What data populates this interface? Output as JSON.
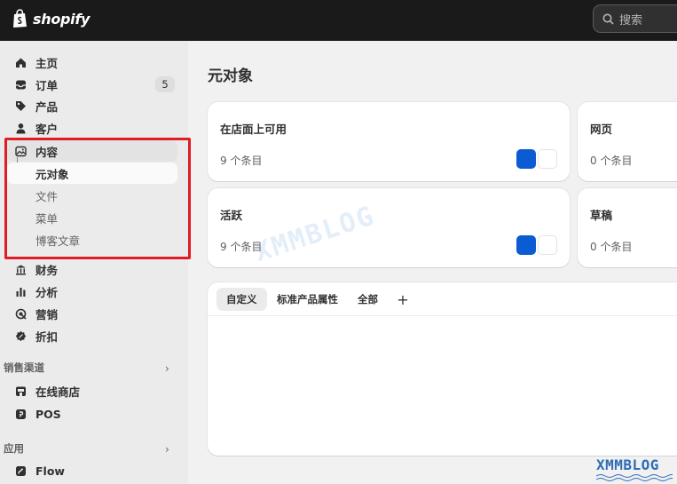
{
  "topbar": {
    "brand": "shopify",
    "search_placeholder": "搜索"
  },
  "sidebar": {
    "items": [
      {
        "label": "主页",
        "icon": "home-icon"
      },
      {
        "label": "订单",
        "icon": "inbox-icon",
        "badge": "5"
      },
      {
        "label": "产品",
        "icon": "tag-icon"
      },
      {
        "label": "客户",
        "icon": "person-icon"
      },
      {
        "label": "内容",
        "icon": "image-icon"
      },
      {
        "label": "财务",
        "icon": "bank-icon"
      },
      {
        "label": "分析",
        "icon": "bar-chart-icon"
      },
      {
        "label": "营销",
        "icon": "target-icon"
      },
      {
        "label": "折扣",
        "icon": "discount-icon"
      }
    ],
    "content_sub": [
      {
        "label": "元对象",
        "active": true
      },
      {
        "label": "文件"
      },
      {
        "label": "菜单"
      },
      {
        "label": "博客文章"
      }
    ],
    "sales_channels_label": "销售渠道",
    "channels": [
      {
        "label": "在线商店",
        "icon": "store-icon"
      },
      {
        "label": "POS",
        "icon": "pos-icon"
      }
    ],
    "apps_label": "应用",
    "apps": [
      {
        "label": "Flow",
        "icon": "flow-icon"
      }
    ]
  },
  "main": {
    "title": "元对象",
    "cards": [
      {
        "title": "在店面上可用",
        "count": "9 个条目"
      },
      {
        "title": "网页",
        "count": "0 个条目"
      },
      {
        "title": "活跃",
        "count": "9 个条目"
      },
      {
        "title": "草稿",
        "count": "0 个条目"
      }
    ],
    "tabs": [
      {
        "label": "自定义",
        "active": true
      },
      {
        "label": "标准产品属性"
      },
      {
        "label": "全部"
      }
    ],
    "add_tab_symbol": "+"
  },
  "watermark": "XMMBLOG",
  "colors": {
    "topbar": "#1a1a1a",
    "accent_blue": "#0b5bd3",
    "highlight_red": "#e11c24"
  }
}
